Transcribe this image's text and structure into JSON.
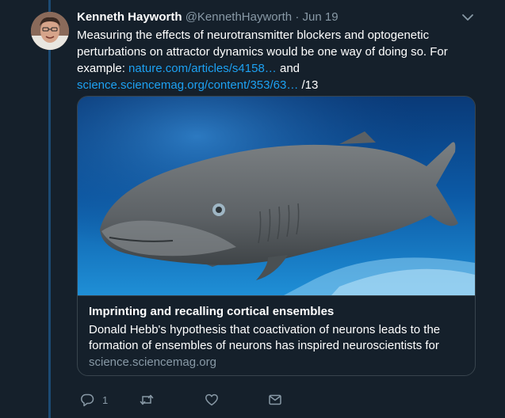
{
  "tweet": {
    "author_name": "Kenneth Hayworth",
    "author_handle": "@KennethHayworth",
    "separator": "·",
    "date": "Jun 19",
    "text_part1": "Measuring the effects of neurotransmitter blockers and optogenetic perturbations on attractor dynamics would be one way of doing so. For example: ",
    "link1": "nature.com/articles/s4158…",
    "text_part2": " and ",
    "link2": "science.sciencemag.org/content/353/63…",
    "text_part3": " /13"
  },
  "card": {
    "title": "Imprinting and recalling cortical ensembles",
    "description": "Donald Hebb's hypothesis that coactivation of neurons leads to the formation of ensembles of neurons has inspired neuroscientists for",
    "domain": "science.sciencemag.org"
  },
  "actions": {
    "reply_count": "1",
    "retweet_count": "",
    "like_count": ""
  },
  "icons": {
    "more": "chevron-down-icon",
    "reply": "reply-icon",
    "retweet": "retweet-icon",
    "like": "heart-icon",
    "dm": "envelope-icon"
  },
  "colors": {
    "background": "#15202b",
    "link": "#1da1f2",
    "muted": "#8899a6",
    "border": "#38444d",
    "thread_line": "#1c4a73"
  }
}
